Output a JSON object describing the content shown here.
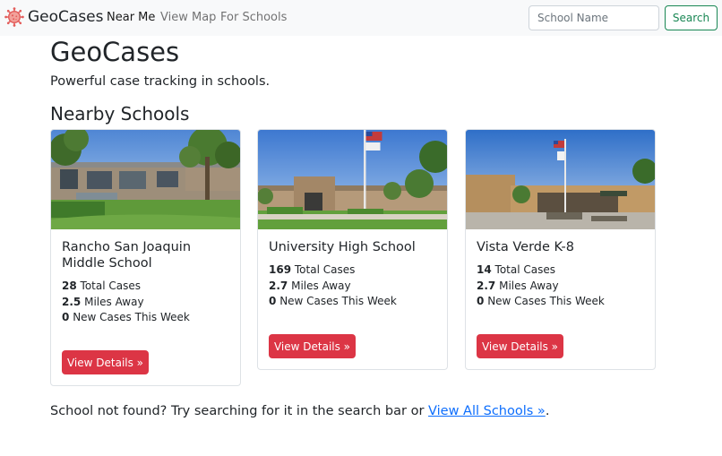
{
  "navbar": {
    "brand": "GeoCases",
    "links": [
      {
        "label": "Near Me",
        "active": true
      },
      {
        "label": "View Map",
        "active": false
      },
      {
        "label": "For Schools",
        "active": false
      }
    ],
    "search": {
      "placeholder": "School Name",
      "value": "",
      "button_label": "Search"
    }
  },
  "hero": {
    "title": "GeoCases",
    "lead": "Powerful case tracking in schools."
  },
  "nearby": {
    "title": "Nearby Schools",
    "schools": [
      {
        "name": "Rancho San Joaquin Middle School",
        "total_cases": "28",
        "miles_away": "2.5",
        "new_cases": "0",
        "photo": "school-building-photo",
        "button_label": "View Details »"
      },
      {
        "name": "University High School",
        "total_cases": "169",
        "miles_away": "2.7",
        "new_cases": "0",
        "photo": "school-entrance-flagpole-photo",
        "button_label": "View Details »"
      },
      {
        "name": "Vista Verde K-8",
        "total_cases": "14",
        "miles_away": "2.7",
        "new_cases": "0",
        "photo": "school-plaza-flagpole-photo",
        "button_label": "View Details »"
      }
    ],
    "stat_labels": {
      "total": "Total Cases",
      "miles": "Miles Away",
      "new": "New Cases This Week"
    }
  },
  "footer": {
    "text": "School not found? Try searching for it in the search bar or ",
    "link": "View All Schools »",
    "suffix": "."
  },
  "colors": {
    "accent_red": "#dc3545",
    "search_green": "#198754",
    "link_blue": "#0d6efd",
    "logo_red": "#e35d5b"
  }
}
